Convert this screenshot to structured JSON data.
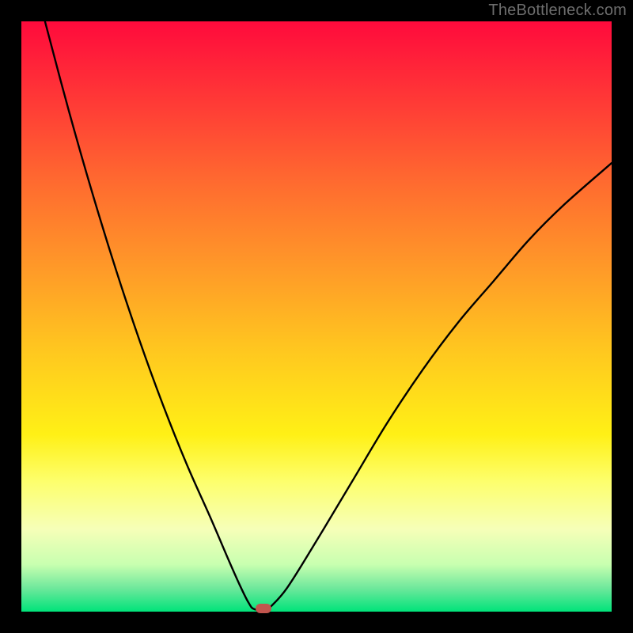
{
  "watermark": "TheBottleneck.com",
  "colors": {
    "frame": "#000000",
    "gradient_top": "#ff0a3c",
    "gradient_bottom": "#00e37a",
    "curve": "#000000",
    "marker": "#c1554e"
  },
  "chart_data": {
    "type": "line",
    "title": "",
    "xlabel": "",
    "ylabel": "",
    "xlim": [
      0,
      100
    ],
    "ylim": [
      0,
      100
    ],
    "series": [
      {
        "name": "curve-left",
        "x": [
          4,
          8,
          12,
          16,
          20,
          24,
          28,
          32,
          35,
          37,
          38.5,
          39.5,
          41.5
        ],
        "y": [
          100,
          85,
          71,
          58,
          46,
          35,
          25,
          16,
          9,
          4.5,
          1.5,
          0.4,
          0.4
        ]
      },
      {
        "name": "curve-right",
        "x": [
          42,
          45,
          50,
          56,
          62,
          68,
          74,
          80,
          86,
          92,
          100
        ],
        "y": [
          0.6,
          4,
          12,
          22,
          32,
          41,
          49,
          56,
          63,
          69,
          76
        ]
      }
    ],
    "marker": {
      "x": 41,
      "y": 0.6
    },
    "annotations": []
  }
}
